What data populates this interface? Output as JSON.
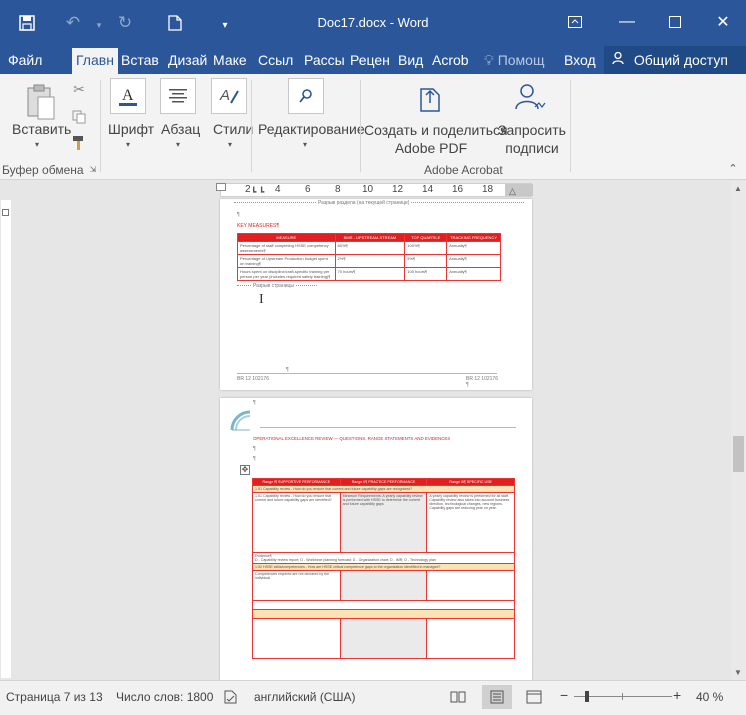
{
  "window": {
    "title": "Doc17.docx - Word"
  },
  "quick_access": {
    "save_icon": "save-icon",
    "undo_icon": "undo-icon",
    "redo_icon": "redo-icon",
    "new_icon": "new-document-icon"
  },
  "tabs": [
    {
      "label": "Файл",
      "active": false
    },
    {
      "label": "Главн",
      "active": true
    },
    {
      "label": "Встав",
      "active": false
    },
    {
      "label": "Дизай",
      "active": false
    },
    {
      "label": "Маке",
      "active": false
    },
    {
      "label": "Ссыл",
      "active": false
    },
    {
      "label": "Рассы",
      "active": false
    },
    {
      "label": "Рецен",
      "active": false
    },
    {
      "label": "Вид",
      "active": false
    },
    {
      "label": "Acrob",
      "active": false
    }
  ],
  "help_tab": "Помощ",
  "login": "Вход",
  "share": "Общий доступ",
  "ribbon": {
    "paste_label": "Вставить",
    "clipboard_group": "Буфер обмена",
    "font_label": "Шрифт",
    "paragraph_label": "Абзац",
    "styles_label": "Стили",
    "editing_label": "Редактирование",
    "create_pdf_line1": "Создать и поделиться",
    "create_pdf_line2": "Adobe PDF",
    "request_sign_line1": "Запросить",
    "request_sign_line2": "подписи",
    "acrobat_group": "Adobe Acrobat"
  },
  "ruler_numbers": [
    "2",
    "4",
    "6",
    "8",
    "10",
    "12",
    "14",
    "16",
    "18"
  ],
  "page1": {
    "section_break": "Разрыв раздела (на текущей странице)",
    "pilcrow": "¶",
    "heading": "KEY MEASURES¶",
    "table_headers": [
      "MEASURE",
      "BMR - UPSTREAM-STREAM",
      "TOP QUARTILE",
      "TRACKING FREQUENCY"
    ],
    "table_rows": [
      [
        "Percentage of staff completing HSSE competency assessments¶",
        "80%¶",
        "100%¶",
        "Annually¶"
      ],
      [
        "Percentage of Upstream Production budget spent on training¶",
        "2%¶",
        "5%¶",
        "Annually¶"
      ],
      [
        "Hours spent on discipline/craft-specific training per person per year (includes required safety training)¶",
        "70 hours¶",
        "100 hours¶",
        "Annually¶"
      ]
    ],
    "page_break": "Разрыв страницы",
    "footer_left": "BR 12 102176",
    "footer_right": "BR 12 102176"
  },
  "page2": {
    "heading": "OPERATIONAL EXCELLENCE REVIEW — QUESTIONS, RANGE STATEMENTS AND EVIDENCES",
    "col_headers": [
      "Range I¶ SUPPORTIVE PERFORMANCE",
      "Range II¶ PRACTICE PERFORMANCE",
      "Range III¶ SPECIFIC USE"
    ],
    "row1_title": "1.51 Capability review - How do you ensure that current and future capability gaps are recognized?",
    "row1_c1": "1.51 Capability review - How do you ensure that current and future capability gaps are identified?",
    "row1_c2": "Minimum Requirements: A yearly capability review is performed with HSSE to determine the current and future capability gaps",
    "row1_c3": "A yearly capability review is performed for all staff. Capability review also takes into account business direction, technological changes, new regions. Capability gaps are reducing year on year.",
    "evidence": "Evidence¶",
    "evidence_text": "D - Capability review report; D - Workforce planning forecast; D - Organization chart; D - IMR; D - Technology plan",
    "row2_title": "1.52 HSSE skills/competencies - How are HSSE critical competence gaps to the organization identified in managed?",
    "row2_c1": "Competences required are not declared by the individual"
  },
  "status": {
    "page": "Страница 7 из 13",
    "words": "Число слов: 1800",
    "language": "английский (США)",
    "zoom": "40 %",
    "zoom_minus": "−",
    "zoom_plus": "+"
  }
}
